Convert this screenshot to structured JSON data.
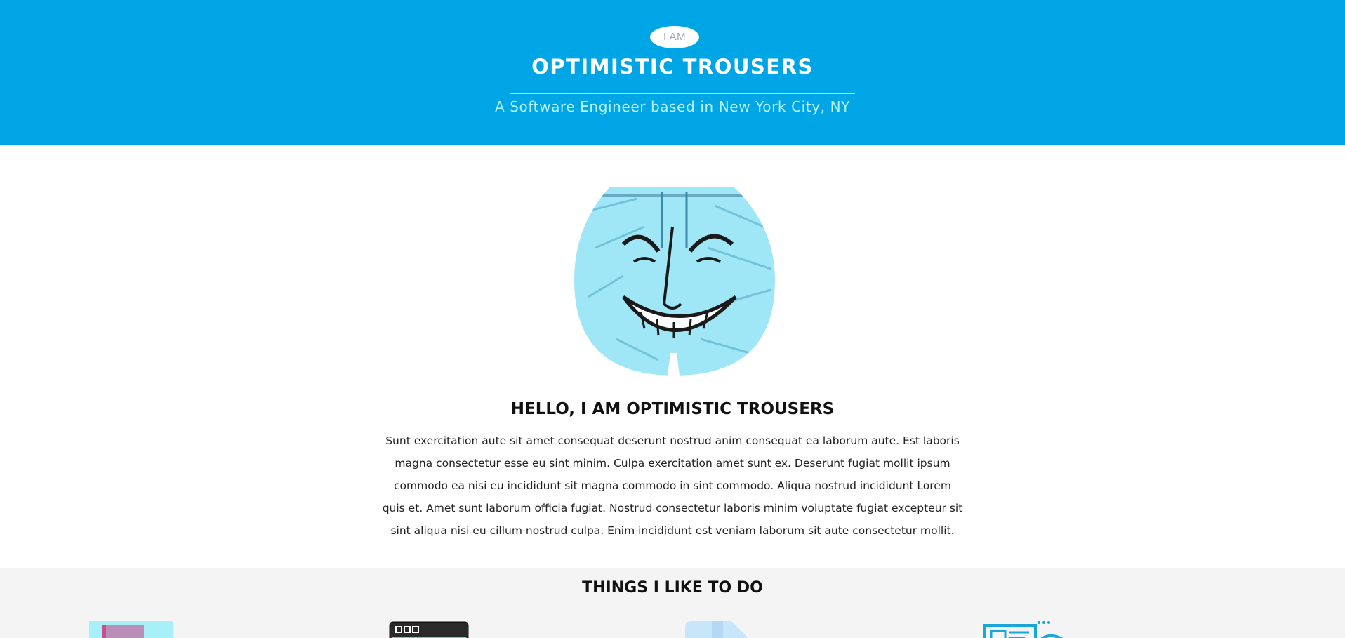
{
  "hero": {
    "pill": "I AM",
    "title": "OPTIMISTIC TROUSERS",
    "subtitle": "A Software Engineer based in New York City, NY",
    "background_color": "#00a5e6"
  },
  "about": {
    "avatar_alt": "smiling trousers",
    "heading": "HELLO, I AM OPTIMISTIC TROUSERS",
    "body": "Sunt exercitation aute sit amet consequat deserunt nostrud anim consequat ea laborum aute. Est laboris magna consectetur esse eu sint minim. Culpa exercitation amet sunt ex. Deserunt fugiat mollit ipsum commodo ea nisi eu incididunt sit magna commodo in sint commodo. Aliqua nostrud incididunt Lorem quis et. Amet sunt laborum officia fugiat. Nostrud consectetur laboris minim voluptate fugiat excepteur sit sint aliqua nisi eu cillum nostrud culpa. Enim incididunt est veniam laborum sit aute consectetur mollit."
  },
  "things": {
    "heading": "THINGS I LIKE TO DO",
    "icons": [
      "design-icon",
      "browser-window-icon",
      "document-icon",
      "web-layout-icon"
    ]
  }
}
